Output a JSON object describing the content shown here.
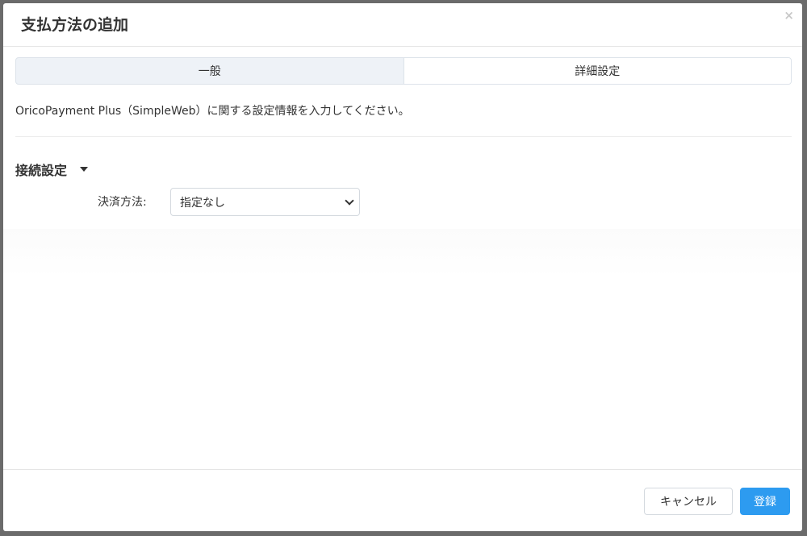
{
  "dialog": {
    "title": "支払方法の追加",
    "close_symbol": "×"
  },
  "tabs": [
    {
      "label": "一般"
    },
    {
      "label": "詳細設定"
    }
  ],
  "description": "OricoPayment Plus（SimpleWeb）に関する設定情報を入力してください。",
  "section": {
    "title": "接続設定",
    "field_label": "決済方法:",
    "select_value": "指定なし"
  },
  "footer": {
    "cancel_label": "キャンセル",
    "submit_label": "登録"
  },
  "colors": {
    "primary": "#2d9bf0",
    "tab_bg": "#eef2f7"
  }
}
